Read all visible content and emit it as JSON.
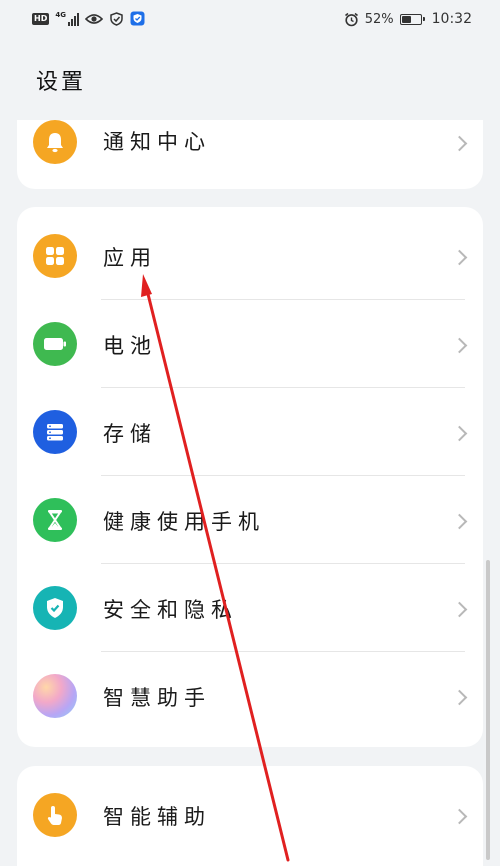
{
  "status_bar": {
    "hd": "HD",
    "network": "4G",
    "battery_percent": "52%",
    "battery_level": 0.52,
    "time": "10:32",
    "icons": [
      "eye-icon",
      "wifi-shield-icon",
      "security-shield-icon",
      "alarm-icon"
    ]
  },
  "page": {
    "title": "设置"
  },
  "settings": {
    "notification": {
      "label": "通知中心",
      "icon": "bell-icon",
      "color": "#f5a623"
    },
    "apps": {
      "label": "应用",
      "icon": "apps-grid-icon",
      "color": "#f5a623"
    },
    "battery": {
      "label": "电池",
      "icon": "battery-icon",
      "color": "#3fb950"
    },
    "storage": {
      "label": "存储",
      "icon": "storage-icon",
      "color": "#1f5fe0"
    },
    "digital_balance": {
      "label": "健康使用手机",
      "icon": "hourglass-icon",
      "color": "#2fbf5a"
    },
    "privacy": {
      "label": "安全和隐私",
      "icon": "shield-check-icon",
      "color": "#16b4b4"
    },
    "assistant": {
      "label": "智慧助手",
      "icon": "gradient-orb-icon",
      "color": "#d6a0ef"
    },
    "accessibility": {
      "label": "智能辅助",
      "icon": "hand-pointer-icon",
      "color": "#f5a623"
    }
  },
  "colors": {
    "background": "#f1f3f5",
    "card": "#ffffff",
    "annotation_arrow": "#e02020"
  }
}
